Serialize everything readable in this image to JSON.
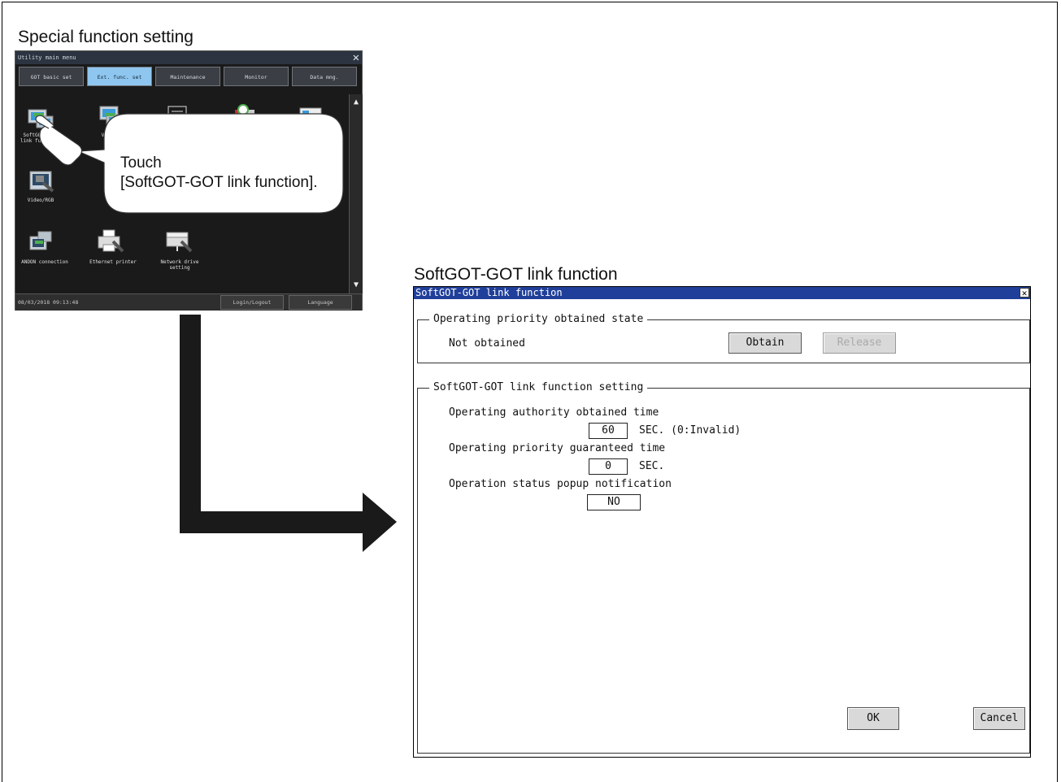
{
  "captions": {
    "left": "Special function setting",
    "right": "SoftGOT-GOT link function"
  },
  "got_screen": {
    "title": "Utility main menu",
    "close_glyph": "✕",
    "tabs": [
      {
        "label": "GOT basic set",
        "active": false
      },
      {
        "label": "Ext. func. set",
        "active": true
      },
      {
        "label": "Maintenance",
        "active": false
      },
      {
        "label": "Monitor",
        "active": false
      },
      {
        "label": "Data mng.",
        "active": false
      }
    ],
    "icons": [
      {
        "name": "softgot-link-icon",
        "label": "SoftGOT-\nlink func."
      },
      {
        "name": "vnc-icon",
        "label": "VNC"
      },
      {
        "name": "ladder-search-icon",
        "label": ""
      },
      {
        "name": "clock-tool-icon",
        "label": ""
      },
      {
        "name": "card-tool-icon",
        "label": ""
      },
      {
        "name": "video-rgb-icon",
        "label": "Video/RGB"
      },
      {
        "name": "andon-connection-icon",
        "label": "ANDON connection"
      },
      {
        "name": "ethernet-printer-icon",
        "label": "Ethernet printer"
      },
      {
        "name": "network-drive-icon",
        "label": "Network drive\nsetting"
      }
    ],
    "status_datetime": "08/03/2018 09:13:48",
    "login_button": "Login/Logout",
    "language_button": "Language"
  },
  "callout": {
    "line1": "Touch",
    "line2": "[SoftGOT-GOT link function]."
  },
  "dialog": {
    "title": "SoftGOT-GOT link function",
    "close_glyph": "✕",
    "group1": {
      "legend": "Operating priority obtained state",
      "status_text": "Not obtained",
      "obtain_label": "Obtain",
      "release_label": "Release"
    },
    "group2": {
      "legend": "SoftGOT-GOT link function setting",
      "authority_label": "Operating authority obtained time",
      "authority_value": "60",
      "authority_unit": "SEC. (0:Invalid)",
      "priority_label": "Operating priority guaranteed time",
      "priority_value": "0",
      "priority_unit": "SEC.",
      "popup_label": "Operation status popup notification",
      "popup_value": "NO"
    },
    "ok_label": "OK",
    "cancel_label": "Cancel"
  },
  "colors": {
    "got_tab_active": "#8fc6ef",
    "dialog_titlebar": "#1f3f9a"
  }
}
